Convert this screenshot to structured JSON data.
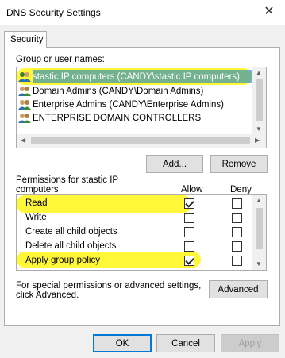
{
  "window": {
    "title": "DNS  Security Settings",
    "close_glyph": "✕"
  },
  "tabs": [
    {
      "label": "Security"
    }
  ],
  "group_section": {
    "label": "Group or user names:",
    "items": [
      {
        "name": "stastic IP computers (CANDY\\stastic IP computers)",
        "icon": "users-group-icon",
        "selected": true,
        "highlighted": true
      },
      {
        "name": "Domain Admins (CANDY\\Domain Admins)",
        "icon": "users-group-icon"
      },
      {
        "name": "Enterprise Admins (CANDY\\Enterprise Admins)",
        "icon": "users-group-icon"
      },
      {
        "name": "ENTERPRISE DOMAIN CONTROLLERS",
        "icon": "users-group-icon"
      }
    ]
  },
  "buttons": {
    "add": "Add...",
    "remove": "Remove",
    "advanced": "Advanced",
    "ok": "OK",
    "cancel": "Cancel",
    "apply": "Apply"
  },
  "permissions": {
    "label_line1": "Permissions for stastic IP",
    "label_line2": "computers",
    "allow_header": "Allow",
    "deny_header": "Deny",
    "rows": [
      {
        "name": "Read",
        "allow": true,
        "deny": false,
        "highlighted": true
      },
      {
        "name": "Write",
        "allow": false,
        "deny": false
      },
      {
        "name": "Create all child objects",
        "allow": false,
        "deny": false
      },
      {
        "name": "Delete all child objects",
        "allow": false,
        "deny": false
      },
      {
        "name": "Apply group policy",
        "allow": true,
        "deny": false,
        "highlighted": true
      }
    ]
  },
  "advanced_text": {
    "line1": "For special permissions or advanced settings,",
    "line2": "click Advanced."
  },
  "colors": {
    "selection": "#0078d7",
    "highlighter": "#fff500",
    "dialog_bg": "#f0f0f0"
  }
}
